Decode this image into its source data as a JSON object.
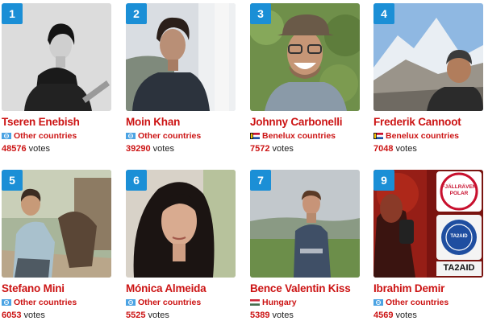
{
  "entries": [
    {
      "rank": "1",
      "name": "Tseren Enebish",
      "country": "Other countries",
      "flag": "globe-flag-icon",
      "votes": "48576",
      "votes_label": "votes"
    },
    {
      "rank": "2",
      "name": "Moin Khan",
      "country": "Other countries",
      "flag": "globe-flag-icon",
      "votes": "39290",
      "votes_label": "votes"
    },
    {
      "rank": "3",
      "name": "Johnny Carbonelli",
      "country": "Benelux countries",
      "flag": "benelux-flag-icon",
      "votes": "7572",
      "votes_label": "votes"
    },
    {
      "rank": "4",
      "name": "Frederik Cannoot",
      "country": "Benelux countries",
      "flag": "benelux-flag-icon",
      "votes": "7048",
      "votes_label": "votes"
    },
    {
      "rank": "5",
      "name": "Stefano Mini",
      "country": "Other countries",
      "flag": "globe-flag-icon",
      "votes": "6053",
      "votes_label": "votes"
    },
    {
      "rank": "6",
      "name": "Mónica Almeida",
      "country": "Other countries",
      "flag": "globe-flag-icon",
      "votes": "5525",
      "votes_label": "votes"
    },
    {
      "rank": "7",
      "name": "Bence Valentin Kiss",
      "country": "Hungary",
      "flag": "hungary-flag-icon",
      "votes": "5389",
      "votes_label": "votes"
    },
    {
      "rank": "9",
      "name": "Ibrahim Demir",
      "country": "Other countries",
      "flag": "globe-flag-icon",
      "votes": "4569",
      "votes_label": "votes"
    }
  ],
  "photo_badges": {
    "fjallraven_badge_line1": "FJÄLLRÄVEN",
    "fjallraven_badge_line2": "POLAR",
    "callsign": "TA2AID"
  },
  "colors": {
    "rank_badge": "#1b8fd6",
    "name_text": "#cc1414",
    "votes_text": "#222222"
  }
}
